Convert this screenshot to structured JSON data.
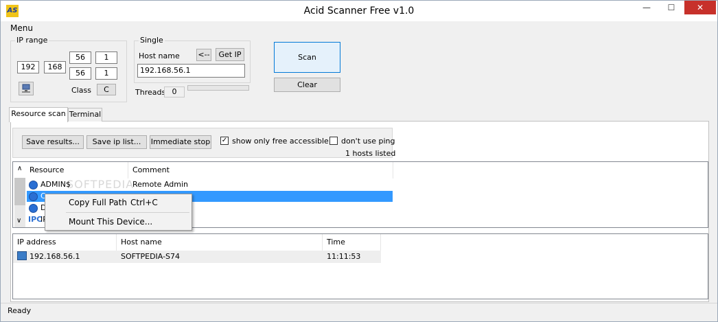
{
  "window": {
    "title": "Acid Scanner Free v1.0",
    "icon_text": "AS",
    "min_glyph": "—",
    "max_glyph": "☐",
    "close_glyph": "✕"
  },
  "menu": {
    "label": "Menu"
  },
  "ip_range": {
    "label": "IP range",
    "octet1": "192",
    "octet2": "168",
    "octet3_start": "56",
    "octet3_end": "56",
    "octet4_start": "1",
    "octet4_end": "1",
    "class_label": "Class",
    "class_value": "C"
  },
  "single": {
    "label": "Single",
    "host_name_label": "Host name",
    "arrow_button": "<--",
    "get_ip_button": "Get IP",
    "host_value": "192.168.56.1"
  },
  "threads": {
    "label": "Threads",
    "value": "0"
  },
  "actions": {
    "scan": "Scan",
    "clear": "Clear"
  },
  "tabs": [
    {
      "label": "Resource scan",
      "active": true
    },
    {
      "label": "Terminal",
      "active": false
    }
  ],
  "toolbar": {
    "save_results": "Save results...",
    "save_ip_list": "Save ip list...",
    "immediate_stop": "Immediate stop",
    "show_only_free": "show only free accessible",
    "show_only_free_checked": true,
    "dont_use_ping": "don't use ping",
    "dont_use_ping_checked": false,
    "hosts_listed": "1 hosts listed"
  },
  "resource_list": {
    "columns": [
      "Resource",
      "Comment"
    ],
    "rows": [
      {
        "resource": "ADMIN$",
        "comment": "Remote Admin"
      },
      {
        "resource": "C",
        "comment": ""
      },
      {
        "resource": "D",
        "comment": ""
      },
      {
        "resource": "IP",
        "comment": ""
      }
    ],
    "watermark": "SOFTPEDIA"
  },
  "context_menu": {
    "items": [
      {
        "label": "Copy Full Path",
        "shortcut": "Ctrl+C"
      },
      {
        "label": "Mount This Device...",
        "shortcut": ""
      }
    ]
  },
  "host_list": {
    "columns": [
      "IP address",
      "Host name",
      "Time"
    ],
    "rows": [
      {
        "ip": "192.168.56.1",
        "host": "SOFTPEDIA-S74",
        "time": "11:11:53"
      }
    ]
  },
  "status": {
    "text": "Ready"
  }
}
